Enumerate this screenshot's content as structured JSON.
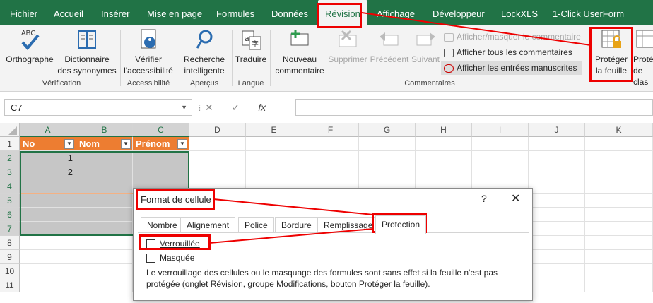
{
  "tabs": [
    "Fichier",
    "Accueil",
    "Insérer",
    "Mise en page",
    "Formules",
    "Données",
    "Révision",
    "Affichage",
    "Développeur",
    "LockXLS",
    "1-Click UserForm"
  ],
  "ribbon": {
    "orthographe": "Orthographe",
    "orthographe_icon_text": "ABC",
    "dictionnaire": [
      "Dictionnaire",
      "des synonymes"
    ],
    "verifier": [
      "Vérifier",
      "l'accessibilité"
    ],
    "recherche": [
      "Recherche",
      "intelligente"
    ],
    "traduire": "Traduire",
    "nouveau": [
      "Nouveau",
      "commentaire"
    ],
    "supprimer": "Supprimer",
    "precedent": "Précédent",
    "suivant": "Suivant",
    "afficher_masquer": "Afficher/masquer le commentaire",
    "afficher_tous": "Afficher tous les commentaires",
    "afficher_entrees": "Afficher les entrées manuscrites",
    "proteger_feuille": [
      "Protéger",
      "la feuille"
    ],
    "proteger_classeur": [
      "Proté",
      "de clas"
    ],
    "groups": [
      "Vérification",
      "Accessibilité",
      "Aperçus",
      "Langue",
      "Commentaires"
    ]
  },
  "formula_bar": {
    "name_box": "C7",
    "fx": "fx",
    "cancel": "✕",
    "enter": "✓"
  },
  "columns": [
    "A",
    "B",
    "C",
    "D",
    "E",
    "F",
    "G",
    "H",
    "I",
    "J",
    "K"
  ],
  "rows": [
    "1",
    "2",
    "3",
    "4",
    "5",
    "6",
    "7",
    "8",
    "9",
    "10",
    "11"
  ],
  "table": {
    "headers": [
      "No",
      "Nom",
      "Prénom"
    ],
    "values": [
      "1",
      "2"
    ]
  },
  "dialog": {
    "title": "Format de cellule",
    "help": "?",
    "close": "✕",
    "tabs": [
      "Nombre",
      "Alignement",
      "Police",
      "Bordure",
      "Remplissage",
      "Protection"
    ],
    "verrouillee": "Verrouillée",
    "masquee": "Masquée",
    "note": "Le verrouillage des cellules ou le masquage des formules sont sans effet si la feuille n'est pas protégée (onglet Révision, groupe Modifications, bouton Protéger la feuille)."
  },
  "colors": {
    "excel_green": "#217346",
    "table_header": "#ed7d31",
    "annotation": "#e00000"
  }
}
